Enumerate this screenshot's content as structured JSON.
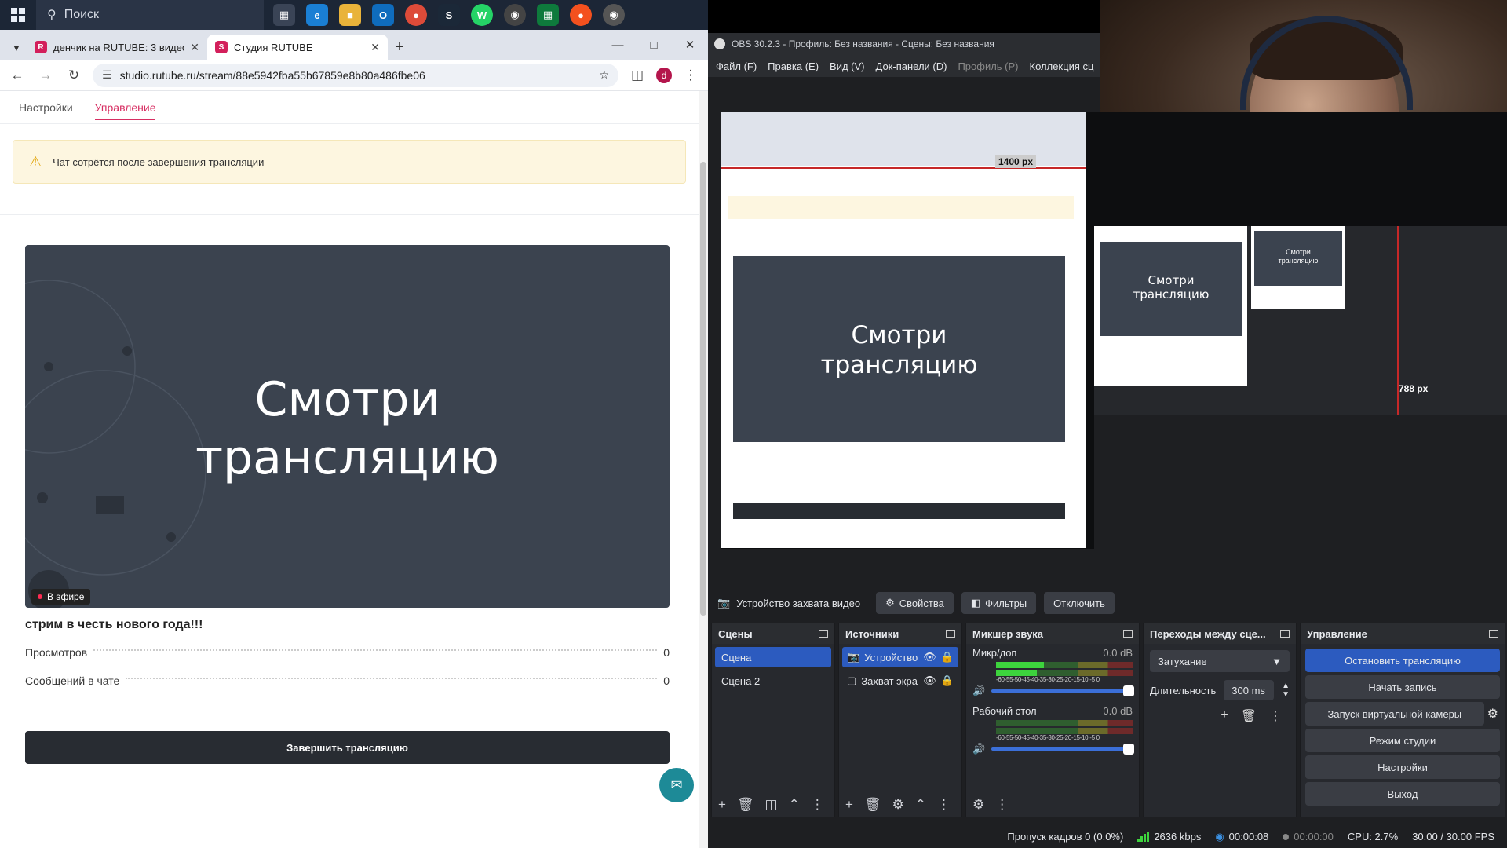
{
  "taskbar": {
    "search_label": "Поиск"
  },
  "browser": {
    "tabs": [
      {
        "title": "денчик на RUTUBE: 3 видео -",
        "active": false
      },
      {
        "title": "Студия RUTUBE",
        "active": true
      }
    ],
    "url": "studio.rutube.ru/stream/88e5942fba55b67859e8b80a486fbe06",
    "profile_initial": "d"
  },
  "page": {
    "tabs": [
      "Настройки",
      "Управление"
    ],
    "active_tab": "Управление",
    "warning": "Чат сотрётся после завершения трансляции",
    "player_text_line1": "Смотри",
    "player_text_line2": "трансляцию",
    "live_badge": "В эфире",
    "stream_title": "стрим в честь нового года!!!",
    "stats": [
      {
        "label": "Просмотров",
        "value": "0"
      },
      {
        "label": "Сообщений в чате",
        "value": "0"
      }
    ],
    "end_button": "Завершить трансляцию"
  },
  "obs": {
    "title": "OBS 30.2.3 - Профиль: Без названия - Сцены: Без названия",
    "menu": [
      "Файл (F)",
      "Правка (E)",
      "Вид (V)",
      "Док-панели (D)",
      "Профиль (P)",
      "Коллекция сц"
    ],
    "preview": {
      "px_label_1": "1400 px",
      "px_label_2": "788 px"
    },
    "source_toolbar": {
      "source_name": "Устройство захвата видео",
      "properties": "Свойства",
      "filters": "Фильтры",
      "disconnect": "Отключить"
    },
    "scenes": {
      "title": "Сцены",
      "items": [
        "Сцена",
        "Сцена 2"
      ],
      "selected": 0
    },
    "sources": {
      "title": "Источники",
      "items": [
        "Устройство",
        "Захват экра"
      ],
      "selected": 0
    },
    "mixer": {
      "title": "Микшер звука",
      "scale": "-60-55-50-45-40-35-30-25-20-15-10 -5  0",
      "channels": [
        {
          "name": "Микр/доп",
          "db": "0.0 dB",
          "level": 0.35
        },
        {
          "name": "Рабочий стол",
          "db": "0.0 dB",
          "level": 0.0
        }
      ]
    },
    "transitions": {
      "title": "Переходы между сце...",
      "type": "Затухание",
      "duration_label": "Длительность",
      "duration": "300 ms"
    },
    "controls": {
      "title": "Управление",
      "buttons": [
        "Остановить трансляцию",
        "Начать запись",
        "Запуск виртуальной камеры",
        "Режим студии",
        "Настройки",
        "Выход"
      ]
    },
    "status": {
      "dropped": "Пропуск кадров 0 (0.0%)",
      "bitrate": "2636 kbps",
      "stream_time": "00:00:08",
      "rec_time": "00:00:00",
      "cpu": "CPU: 2.7%",
      "fps": "30.00 / 30.00 FPS"
    },
    "colors": {
      "accent": "#2c5bbf",
      "panel": "#27292e"
    }
  }
}
